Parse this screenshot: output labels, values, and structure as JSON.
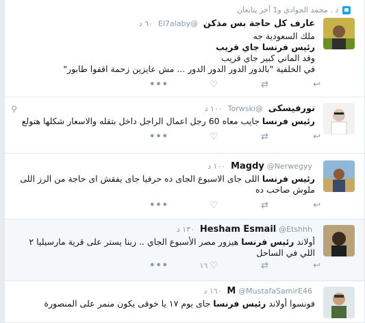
{
  "tweets": [
    {
      "context": "د . محمد الجوادي و1 آخر يتابعان",
      "name": "عارف كل حاجة بس مذكن",
      "handle": "@El7alaby",
      "time": "٦٠ د",
      "lines": [
        "ملك السعودية جه",
        "رئيس فرنسا جاي قريب",
        "وقد الماني كبير جاي قريب",
        "في الخلفية \"بالدور الدور الدور الدور ... مش عايزين زحمة اقفوا طابور\""
      ],
      "retweets": "",
      "likes": ""
    },
    {
      "name": "نورفيسكى",
      "handle": "@Torwski",
      "time": "١٠٠ د",
      "lines": [
        "رئيس فرنسا جايب معاه 60 رجل اعمال الراجل داخل بتقله والاسعار شكلها هتولع"
      ],
      "retweets": "",
      "likes": ""
    },
    {
      "name": "Magdy",
      "handle": "@Nerwegyy",
      "time": "١٠٠ د",
      "lines": [
        "رئيس فرنسا اللى جاى الاسبوع الجاى ده حرفيا جاى يفقش اى حاجة من الرز اللى ملوش صاحب ده"
      ],
      "retweets": "",
      "likes": ""
    },
    {
      "name": "Hesham Esmail",
      "handle": "@Etshhh",
      "time": "١٣٠ د",
      "lines": [
        "أولاند رئيس فرنسا هيزور مصر الأسبوع الجاي .. ربنا يستر على قرية مارسيليا ٢ اللي في الساحل"
      ],
      "retweets": "",
      "likes": "١٦"
    },
    {
      "name": "M",
      "handle": "@MustafaSamirE46",
      "time": "١٦٠ د",
      "lines": [
        "فونسوا أولاند رئيس فرنسا جاى يوم ١٧ يا خوفى يكون منمر على المنصورة"
      ],
      "retweets": "",
      "likes": ""
    }
  ],
  "highlight": "رئيس فرنسا"
}
